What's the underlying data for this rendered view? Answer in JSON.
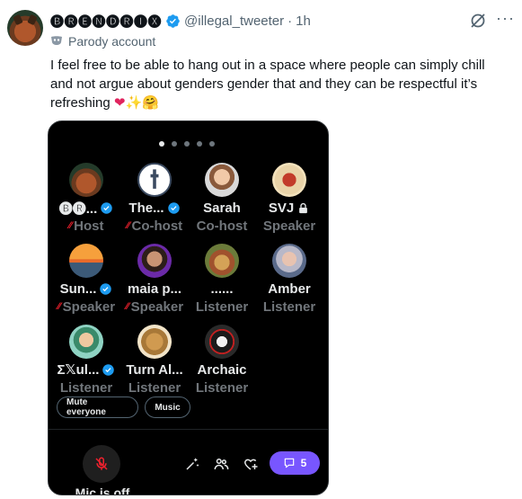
{
  "tweet": {
    "display_name": "🅑🅡🅔🅝🅓🅡🅘🅧",
    "handle": "@illegal_tweeter",
    "separator": "·",
    "time": "1h",
    "label": "Parody account",
    "text": "I feel free to be able to hang out in a space where people can simply chill and not argue about genders gender that and they can be respectful it’s refreshing",
    "emojis": [
      "❤",
      "✨",
      "🤗"
    ],
    "icons": [
      "avatar-raccoon",
      "verified-badge",
      "grok-icon",
      "more-icon",
      "parody-mask-icon"
    ],
    "colors": {
      "verified": "#1d9bf0",
      "secondary_text": "#536471",
      "mute_red": "#f4212e",
      "chat_purple": "#7856ff"
    }
  },
  "space": {
    "pages": 5,
    "active_page": 1,
    "participants": [
      {
        "name": "🅑🅡...",
        "verified": true,
        "role": "Host",
        "muted": true,
        "avatar": "raccoon"
      },
      {
        "name": "The...",
        "verified": true,
        "role": "Co-host",
        "muted": true,
        "avatar": "statue"
      },
      {
        "name": "Sarah",
        "verified": false,
        "role": "Co-host",
        "muted": false,
        "avatar": "woman"
      },
      {
        "name": "SVJ",
        "verified": false,
        "locked": true,
        "role": "Speaker",
        "muted": false,
        "avatar": "masked"
      },
      {
        "name": "Sun...",
        "verified": true,
        "role": "Speaker",
        "muted": true,
        "avatar": "sunset"
      },
      {
        "name": "maia p...",
        "verified": false,
        "role": "Speaker",
        "muted": true,
        "avatar": "person"
      },
      {
        "name": "......",
        "verified": false,
        "role": "Listener",
        "muted": false,
        "avatar": "food"
      },
      {
        "name": "Amber",
        "verified": false,
        "role": "Listener",
        "muted": false,
        "avatar": "woman-glasses"
      },
      {
        "name": "Σ𝕏ul...",
        "verified": true,
        "role": "Listener",
        "muted": false,
        "avatar": "cartoon"
      },
      {
        "name": "Turn Al...",
        "verified": false,
        "role": "Listener",
        "muted": false,
        "avatar": "dog"
      },
      {
        "name": "Archaic",
        "verified": false,
        "role": "Listener",
        "muted": false,
        "avatar": "bird"
      }
    ],
    "buttons": {
      "mute_everyone": "Mute everyone",
      "music": "Music"
    },
    "mic_label": "Mic is off",
    "chat_count": "5",
    "toolbar_icons": [
      "effects-icon",
      "people-icon",
      "heart-add-icon",
      "chat-icon"
    ]
  }
}
